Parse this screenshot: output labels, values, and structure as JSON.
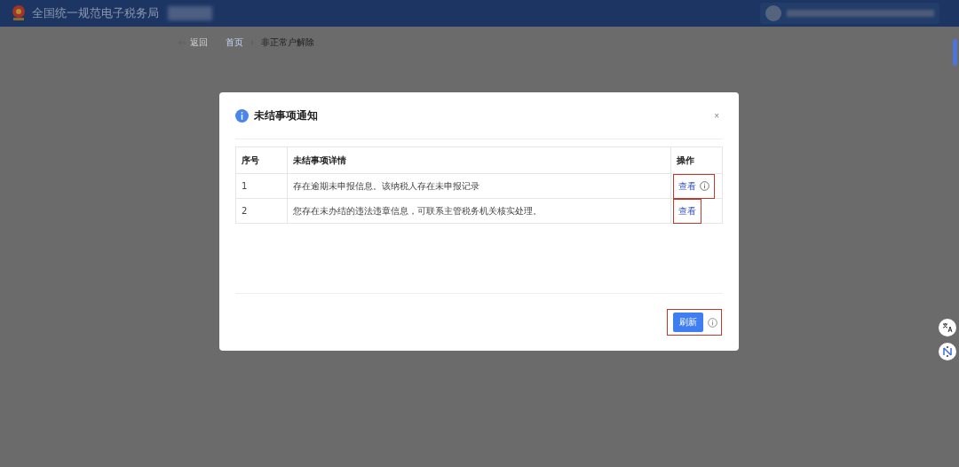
{
  "header": {
    "title": "全国统一规范电子税务局"
  },
  "breadcrumb": {
    "back": "返回",
    "items": [
      {
        "label": "首页",
        "kind": "link"
      },
      {
        "label": "非正常户解除",
        "kind": "current"
      }
    ]
  },
  "dialog": {
    "title": "未结事项通知",
    "close": "×",
    "table": {
      "columns": [
        "序号",
        "未结事项详情",
        "操作"
      ],
      "rows": [
        {
          "index": "1",
          "detail": "存在逾期未申报信息。该纳税人存在未申报记录",
          "action": "查看",
          "info": true,
          "highlighted": true
        },
        {
          "index": "2",
          "detail": "您存在未办结的违法违章信息，可联系主管税务机关核实处理。",
          "action": "查看",
          "info": false,
          "highlighted": true
        }
      ]
    },
    "refresh": {
      "label": "刷新",
      "info": true,
      "highlighted": true
    }
  }
}
